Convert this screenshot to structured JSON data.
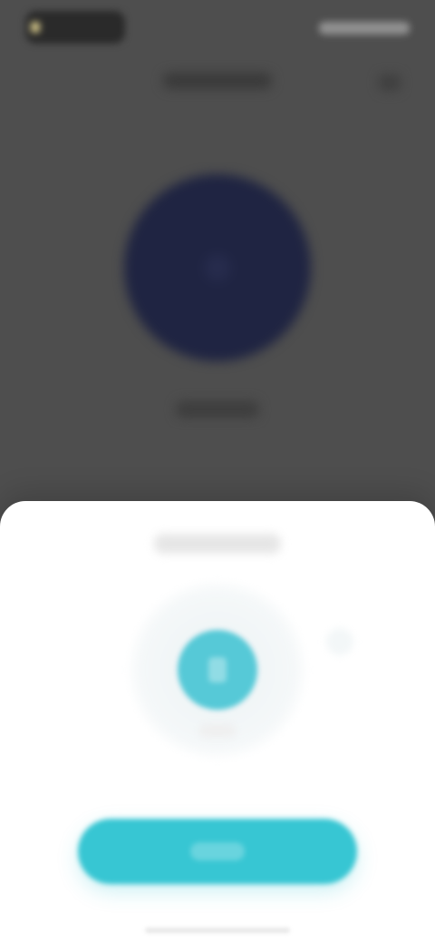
{
  "screen": {
    "status_bar": {
      "left_text": "",
      "right_text": ""
    },
    "top_bar": {
      "title": "",
      "action_icon": "more-icon"
    },
    "hero": {
      "label": ""
    },
    "sheet": {
      "title": "",
      "primary_action_icon": "mic-icon",
      "primary_action_caption": "",
      "primary_button_label": ""
    },
    "colors": {
      "overlay": "#4e4e4e",
      "hero_circle": "#1f2442",
      "accent": "#37c6d3",
      "sheet_bg": "#ffffff"
    }
  }
}
